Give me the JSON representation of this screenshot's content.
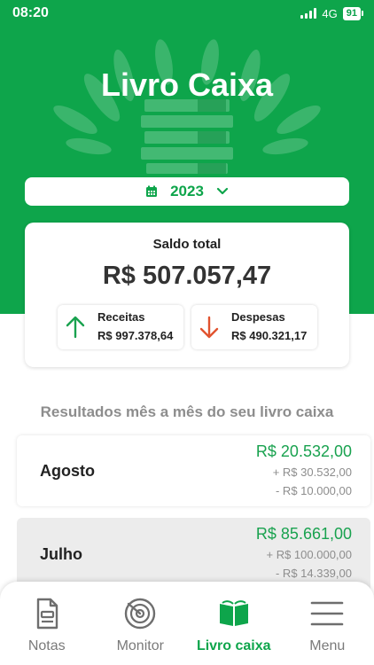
{
  "status": {
    "time": "08:20",
    "network": "4G",
    "battery": "91"
  },
  "header": {
    "title": "Livro Caixa",
    "year": "2023",
    "calendar_icon": "calendar-icon",
    "year_dropdown_icon": "chevron-down-icon"
  },
  "summary": {
    "label": "Saldo total",
    "value": "R$ 507.057,47",
    "receitas": {
      "label": "Receitas",
      "value": "R$ 997.378,64",
      "icon": "arrow-up-icon",
      "color": "#19a24f"
    },
    "despesas": {
      "label": "Despesas",
      "value": "R$ 490.321,17",
      "icon": "arrow-down-icon",
      "color": "#e1532f"
    }
  },
  "monthly": {
    "title": "Resultados mês a mês do seu livro caixa",
    "items": [
      {
        "month": "Agosto",
        "total": "R$ 20.532,00",
        "income": "+ R$ 30.532,00",
        "expense": "- R$ 10.000,00"
      },
      {
        "month": "Julho",
        "total": "R$ 85.661,00",
        "income": "+ R$ 100.000,00",
        "expense": "- R$ 14.339,00"
      }
    ]
  },
  "nav": {
    "items": [
      {
        "label": "Notas",
        "icon": "document-icon",
        "active": false
      },
      {
        "label": "Monitor",
        "icon": "radar-icon",
        "active": false
      },
      {
        "label": "Livro caixa",
        "icon": "book-icon",
        "active": true
      },
      {
        "label": "Menu",
        "icon": "hamburger-menu-icon",
        "active": false
      }
    ]
  },
  "colors": {
    "brand_green": "#0ea54b",
    "positive": "#19a24f",
    "negative": "#e1532f",
    "muted_text": "#8d8d8d"
  }
}
